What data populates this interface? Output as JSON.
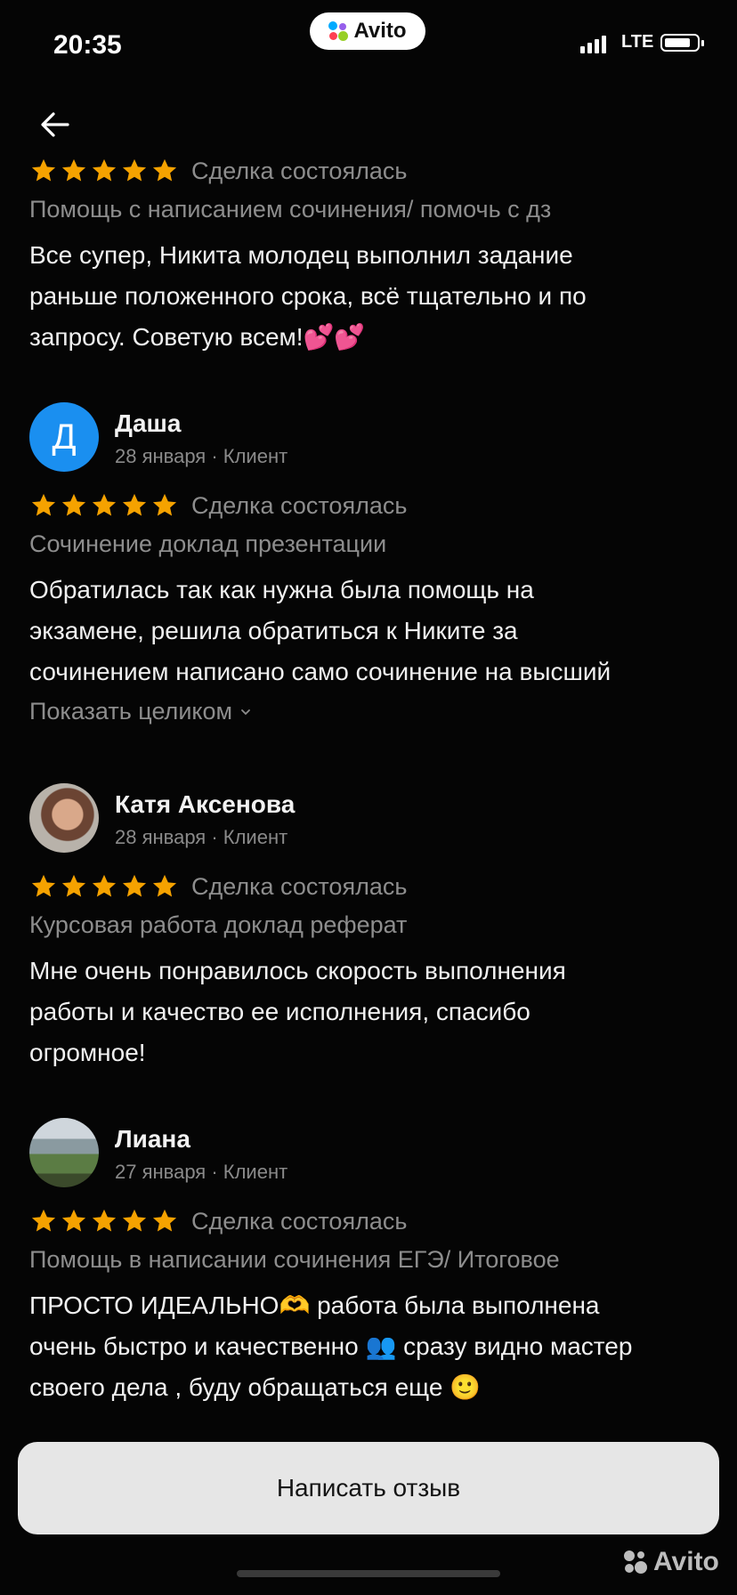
{
  "status_bar": {
    "time": "20:35",
    "network": "LTE"
  },
  "brand": {
    "name": "Avito"
  },
  "colors": {
    "star": "#f5a200",
    "avatar_letter_bg": "#1a8ff0",
    "button_bg": "#e6e6e6"
  },
  "reviews": [
    {
      "deal_status": "Сделка состоялась",
      "service": "Помощь с написанием сочинения/ помочь с дз",
      "text_lines": [
        "Все супер, Никита молодец  выполнил задание",
        "раньше положенного срока, всё тщательно и по",
        "запросу. Советую всем!💕💕"
      ]
    },
    {
      "author": "Даша",
      "avatar_letter": "Д",
      "meta": "28 января · Клиент",
      "deal_status": "Сделка состоялась",
      "service": "Сочинение доклад презентации",
      "text_lines": [
        "Обратилась так как нужна была помощь на",
        "экзамене, решила обратиться к Никите за",
        "сочинением написано само сочинение на высший"
      ],
      "show_more": "Показать целиком"
    },
    {
      "author": "Катя Аксенова",
      "meta": "28 января · Клиент",
      "deal_status": "Сделка состоялась",
      "service": "Курсовая работа доклад реферат",
      "text_lines": [
        "Мне очень понравилось скорость выполнения",
        "работы и качество ее исполнения, спасибо",
        "огромное!"
      ]
    },
    {
      "author": "Лиана",
      "meta": "27 января · Клиент",
      "deal_status": "Сделка состоялась",
      "service": "Помощь в написании сочинения ЕГЭ/ Итоговое",
      "text_lines": [
        "ПРОСТО ИДЕАЛЬНО🫶 работа была выполнена",
        "очень быстро и качественно 👥 сразу видно мастер",
        "своего дела , буду обращаться еще 🙂"
      ]
    }
  ],
  "write_review_button": "Написать отзыв",
  "watermark": "Avito"
}
